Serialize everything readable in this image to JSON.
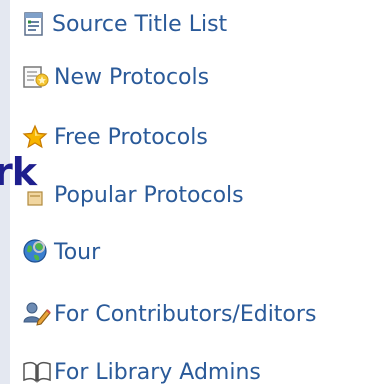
{
  "background_word": "rk",
  "menu": {
    "items": [
      {
        "label": "Source Title List",
        "icon": "document-list-icon"
      },
      {
        "label": "New Protocols",
        "icon": "new-document-icon"
      },
      {
        "label": "Free Protocols",
        "icon": "star-icon"
      },
      {
        "label": "Popular Protocols",
        "icon": "popular-icon"
      },
      {
        "label": "Tour",
        "icon": "globe-icon"
      },
      {
        "label": "For Contributors/Editors",
        "icon": "users-icon"
      },
      {
        "label": "For Library Admins",
        "icon": "open-book-icon"
      }
    ]
  },
  "colors": {
    "link": "#2a5a99",
    "heading_fragment": "#1e1f8e",
    "left_rule": "#e4e8f1"
  }
}
